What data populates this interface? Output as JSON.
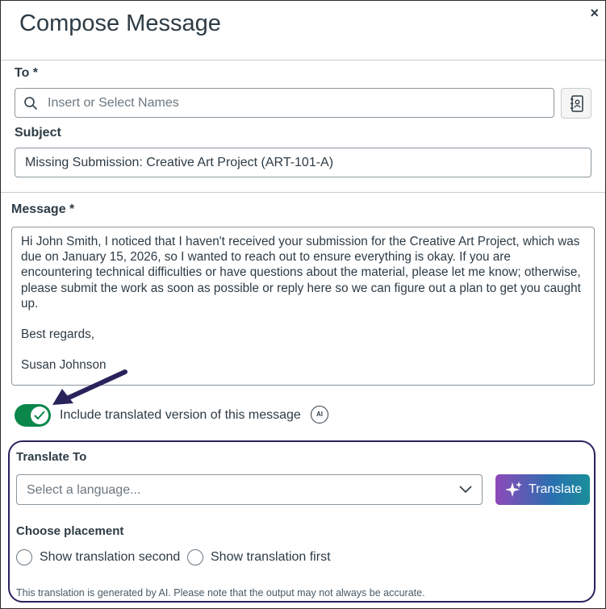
{
  "header": {
    "title": "Compose Message",
    "close": "×"
  },
  "to": {
    "label": "To *",
    "placeholder": "Insert or Select Names"
  },
  "subject": {
    "label": "Subject",
    "value": "Missing Submission: Creative Art Project (ART-101-A)"
  },
  "message": {
    "label": "Message *",
    "body": "Hi John Smith, I noticed that I haven't received your submission for the Creative Art Project, which was due on January 15, 2026, so I wanted to reach out to ensure everything is okay. If you are encountering technical difficulties or have questions about the material, please let me know; otherwise, please submit the work as soon as possible or reply here so we can figure out a plan to get you caught up.",
    "closing": "Best regards,",
    "signature": "Susan Johnson"
  },
  "translation_toggle": {
    "label": "Include translated version of this message",
    "on": true,
    "badge": "AI"
  },
  "translate": {
    "label": "Translate To",
    "select_placeholder": "Select a language...",
    "button": "Translate",
    "placement_label": "Choose placement",
    "options": [
      "Show translation second",
      "Show translation first"
    ],
    "disclaimer": "This translation is generated by AI. Please note that the output may not always be accurate."
  },
  "colors": {
    "toggle_on": "#0b874b",
    "panel_border": "#29235c",
    "arrow": "#29235c"
  }
}
